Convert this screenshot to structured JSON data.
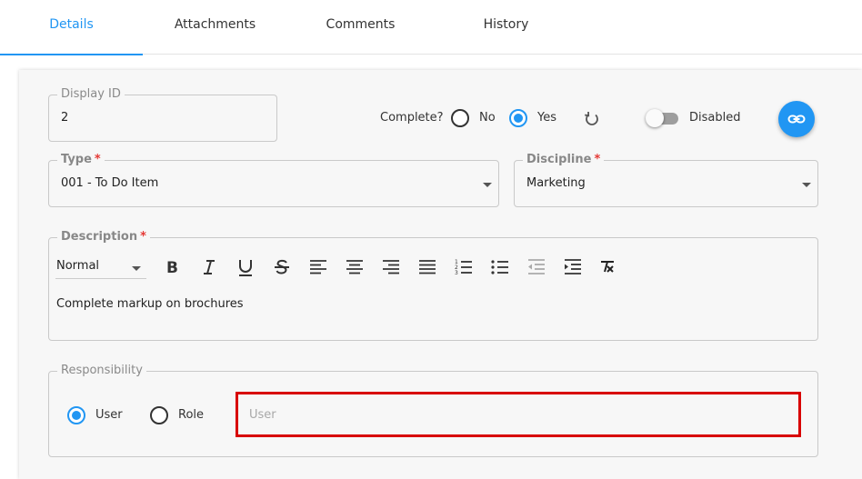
{
  "tabs": [
    {
      "label": "Details",
      "active": true
    },
    {
      "label": "Attachments",
      "active": false
    },
    {
      "label": "Comments",
      "active": false
    },
    {
      "label": "History",
      "active": false
    }
  ],
  "display_id": {
    "label": "Display ID",
    "value": "2"
  },
  "complete": {
    "label": "Complete?",
    "no_label": "No",
    "yes_label": "Yes",
    "selected": "Yes"
  },
  "status_toggle": {
    "label": "Disabled",
    "on": false
  },
  "link_button": {
    "icon": "link-icon"
  },
  "type_field": {
    "label": "Type",
    "required_mark": "*",
    "value": "001 - To Do Item"
  },
  "discipline_field": {
    "label": "Discipline",
    "required_mark": "*",
    "value": "Marketing"
  },
  "description": {
    "label": "Description",
    "required_mark": "*",
    "format": "Normal",
    "text": "Complete markup on brochures",
    "toolbar": [
      "bold-icon",
      "italic-icon",
      "underline-icon",
      "strikethrough-icon",
      "align-left-icon",
      "align-center-icon",
      "align-right-icon",
      "align-justify-icon",
      "ordered-list-icon",
      "bullet-list-icon",
      "outdent-icon",
      "indent-icon",
      "clear-format-icon"
    ]
  },
  "responsibility": {
    "label": "Responsibility",
    "user_label": "User",
    "role_label": "Role",
    "selected": "User",
    "input_placeholder": "User",
    "input_value": ""
  },
  "colors": {
    "accent": "#2196f3",
    "highlight": "#d80000",
    "required": "#e53935"
  }
}
